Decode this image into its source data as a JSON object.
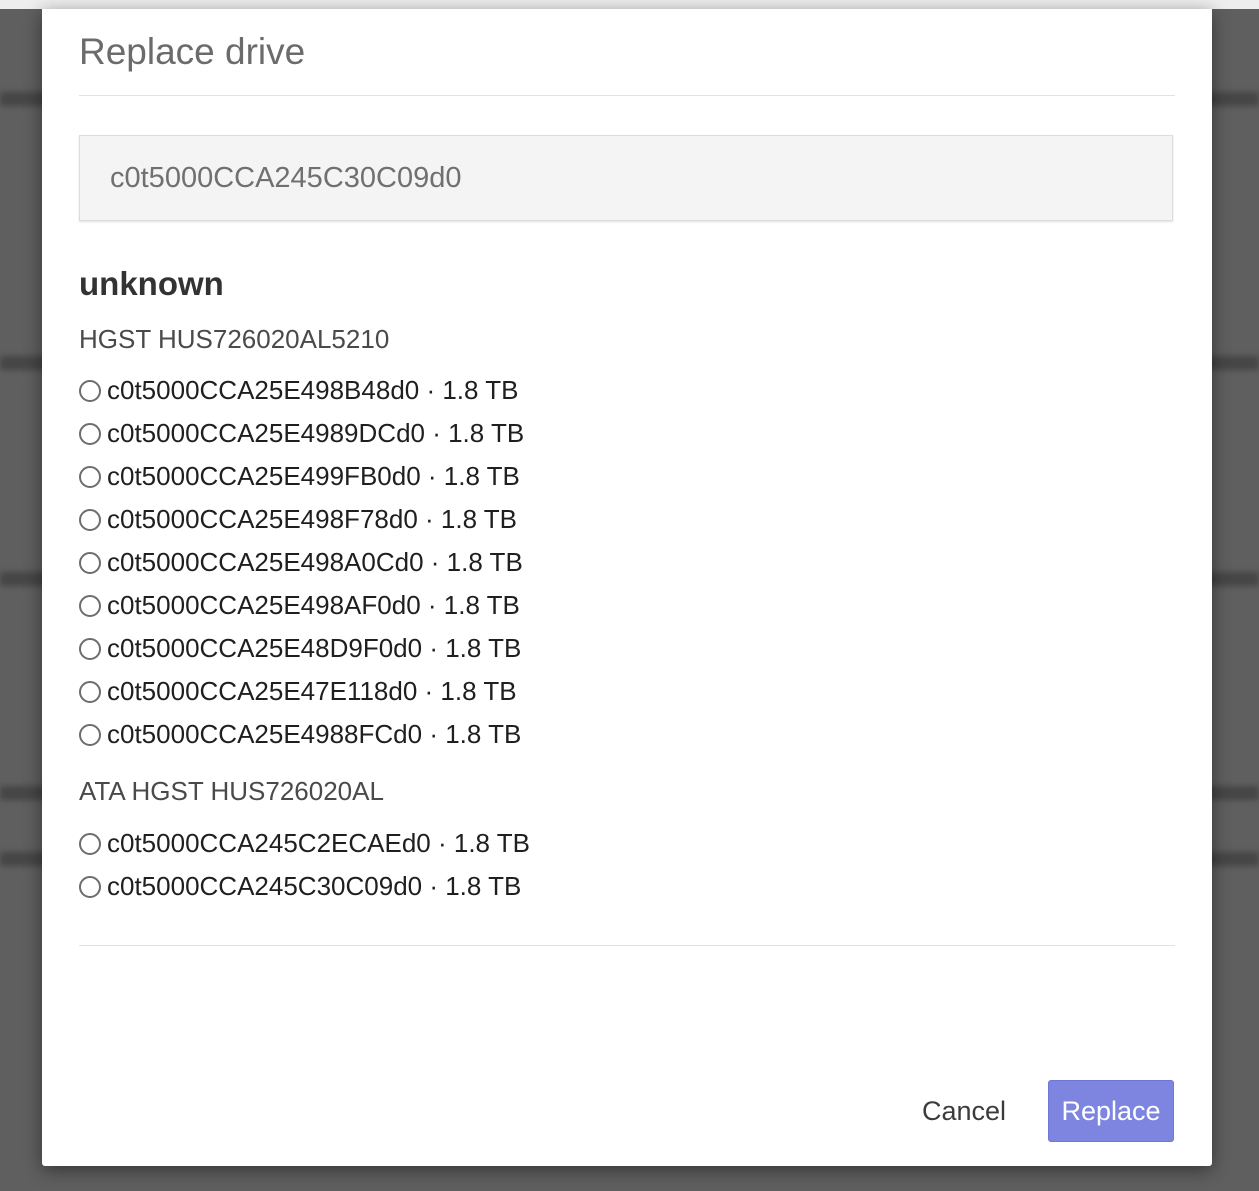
{
  "dialog": {
    "title": "Replace drive",
    "selected_drive": "c0t5000CCA245C30C09d0",
    "pool_name": "unknown",
    "groups": [
      {
        "model": "HGST HUS726020AL5210",
        "drives": [
          "c0t5000CCA25E498B48d0 · 1.8 TB",
          "c0t5000CCA25E4989DCd0 · 1.8 TB",
          "c0t5000CCA25E499FB0d0 · 1.8 TB",
          "c0t5000CCA25E498F78d0 · 1.8 TB",
          "c0t5000CCA25E498A0Cd0 · 1.8 TB",
          "c0t5000CCA25E498AF0d0 · 1.8 TB",
          "c0t5000CCA25E48D9F0d0 · 1.8 TB",
          "c0t5000CCA25E47E118d0 · 1.8 TB",
          "c0t5000CCA25E4988FCd0 · 1.8 TB"
        ]
      },
      {
        "model": "ATA HGST HUS726020AL",
        "drives": [
          "c0t5000CCA245C2ECAEd0 · 1.8 TB",
          "c0t5000CCA245C30C09d0 · 1.8 TB"
        ]
      }
    ],
    "cancel_label": "Cancel",
    "replace_label": "Replace"
  },
  "colors": {
    "accent": "#7d85e0",
    "overlay": "#5f5f5f"
  },
  "icons": {
    "radio": "radio-unchecked-icon"
  }
}
